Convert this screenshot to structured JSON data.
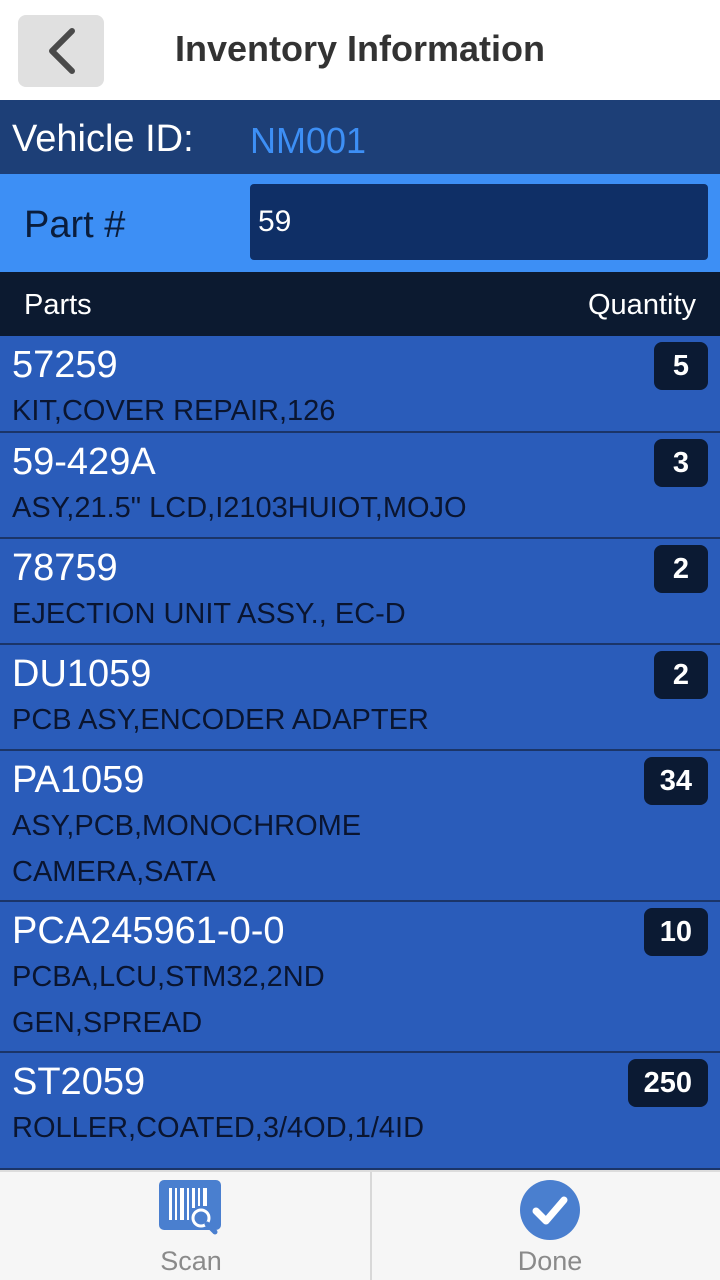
{
  "header": {
    "title": "Inventory Information",
    "back_icon": "chevron-left-icon"
  },
  "vehicle": {
    "label": "Vehicle ID:",
    "value": "NM001"
  },
  "part": {
    "label": "Part #",
    "value": "59"
  },
  "columns": {
    "parts": "Parts",
    "quantity": "Quantity"
  },
  "items": [
    {
      "number": "57259",
      "description": "KIT,COVER REPAIR,126",
      "quantity": "5"
    },
    {
      "number": "59-429A",
      "description": "ASY,21.5\" LCD,I2103HUIOT,MOJO",
      "quantity": "3"
    },
    {
      "number": "78759",
      "description": "EJECTION UNIT ASSY., EC-D",
      "quantity": "2"
    },
    {
      "number": "DU1059",
      "description": "PCB ASY,ENCODER ADAPTER",
      "quantity": "2"
    },
    {
      "number": "PA1059",
      "description": "ASY,PCB,MONOCHROME CAMERA,SATA",
      "quantity": "34"
    },
    {
      "number": "PCA245961-0-0",
      "description": "PCBA,LCU,STM32,2ND GEN,SPREAD",
      "quantity": "10"
    },
    {
      "number": "ST2059",
      "description": "ROLLER,COATED,3/4OD,1/4ID",
      "quantity": "250"
    }
  ],
  "footer": {
    "scan_label": "Scan",
    "scan_icon": "barcode-scan-icon",
    "done_label": "Done",
    "done_icon": "checkmark-circle-icon"
  },
  "colors": {
    "header_dark": "#1d3f77",
    "accent_blue": "#3d8ff5",
    "list_blue": "#2a5cba",
    "badge_dark": "#0b1a33"
  }
}
